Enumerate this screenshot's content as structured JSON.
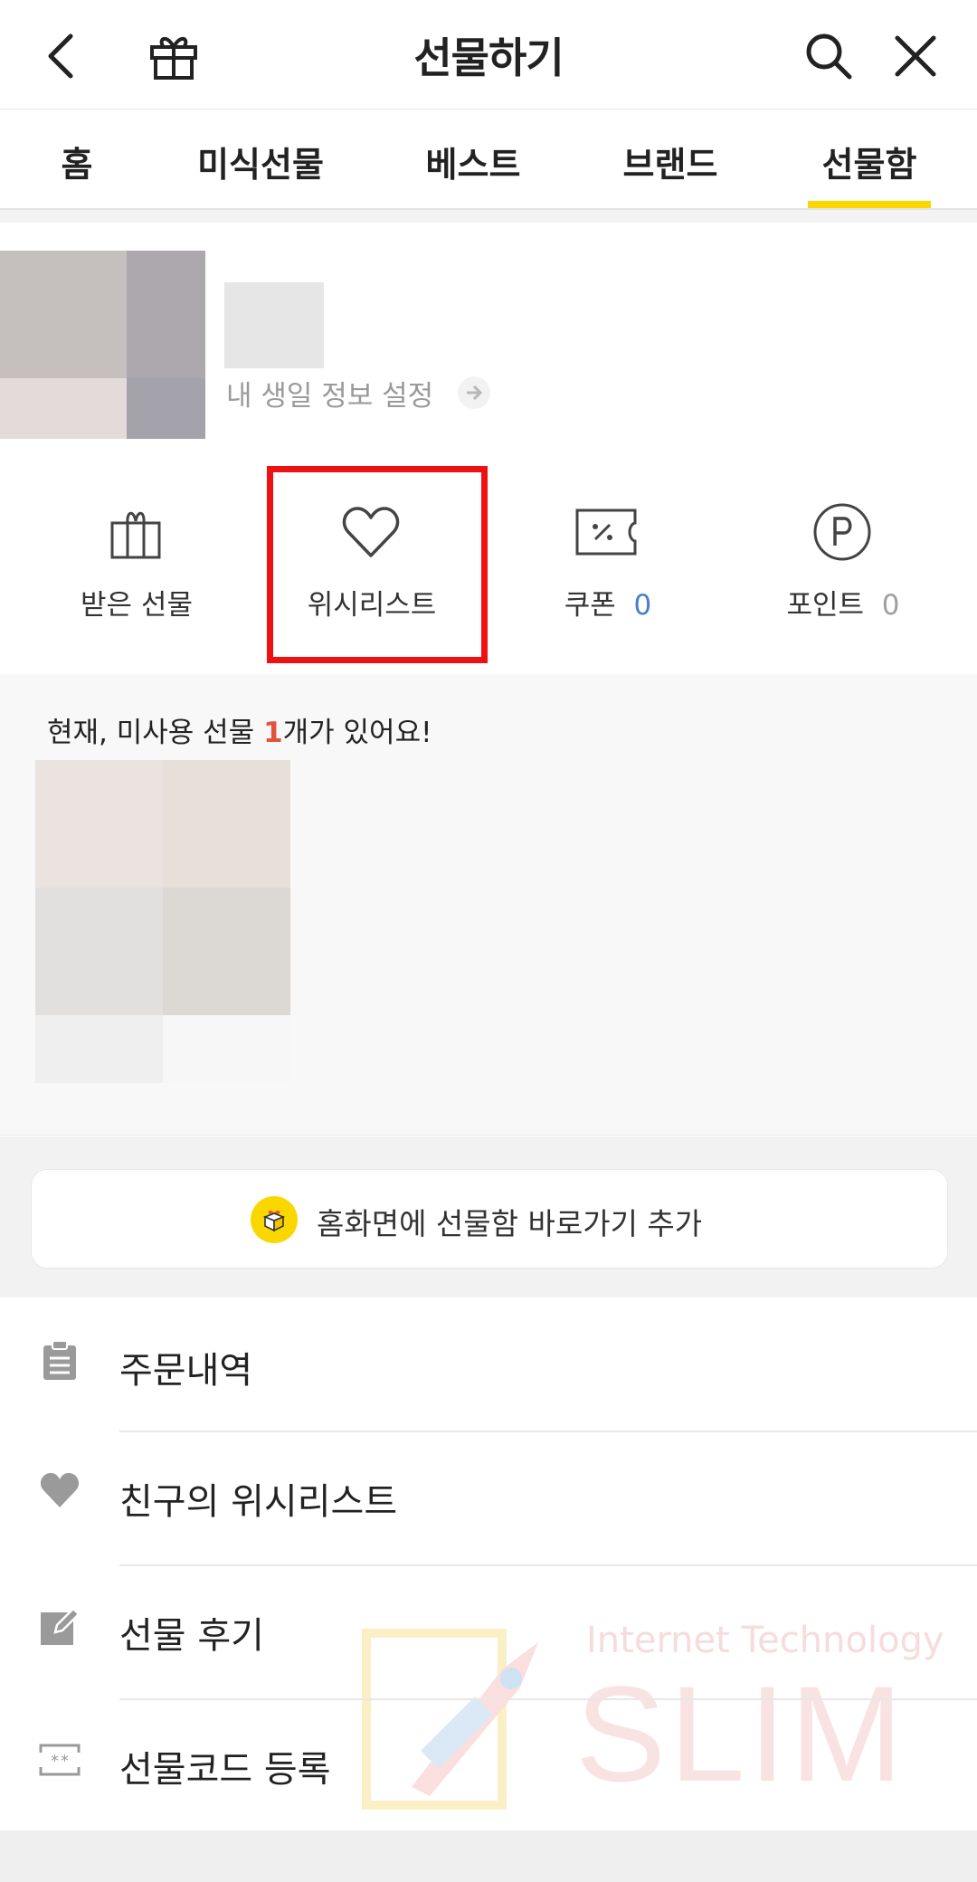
{
  "header": {
    "title": "선물하기",
    "back_icon": "back-icon",
    "gift_icon": "gift-icon",
    "search_icon": "search-icon",
    "close_icon": "close-icon"
  },
  "tabs": [
    {
      "label": "홈"
    },
    {
      "label": "미식선물"
    },
    {
      "label": "베스트"
    },
    {
      "label": "브랜드"
    },
    {
      "label": "선물함",
      "active": true
    }
  ],
  "accent_color": "#fbd700",
  "profile": {
    "birthday_link": "내 생일 정보 설정"
  },
  "quick_menu": [
    {
      "label": "받은 선물",
      "icon": "gift-box-icon"
    },
    {
      "label": "위시리스트",
      "icon": "heart-icon",
      "highlighted": true
    },
    {
      "label": "쿠폰",
      "count": "0",
      "icon": "coupon-icon"
    },
    {
      "label": "포인트",
      "count": "0",
      "icon": "point-icon"
    }
  ],
  "unused_gift": {
    "prefix": "현재, 미사용 선물 ",
    "count": "1",
    "suffix": "개가 있어요!"
  },
  "shortcut": {
    "label": "홈화면에 선물함 바로가기 추가",
    "icon": "gift-shortcut-icon"
  },
  "menu_list": [
    {
      "label": "주문내역",
      "icon": "clipboard-icon"
    },
    {
      "label": "친구의 위시리스트",
      "icon": "heart-filled-icon"
    },
    {
      "label": "선물 후기",
      "icon": "edit-icon"
    },
    {
      "label": "선물코드 등록",
      "icon": "code-icon"
    }
  ],
  "watermark": {
    "small": "Internet Technology",
    "big": "SLIM"
  }
}
